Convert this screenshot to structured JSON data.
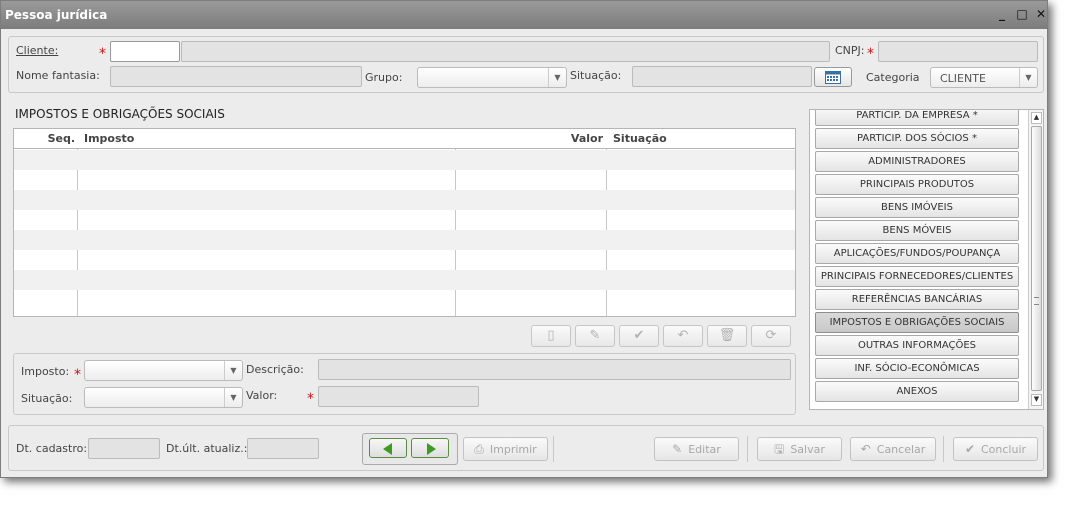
{
  "window": {
    "title": "Pessoa jurídica",
    "minimize": "_",
    "maximize": "□",
    "close": "✕"
  },
  "header": {
    "cliente_label": "Cliente:",
    "cnpj_label": "CNPJ:",
    "nome_fantasia_label": "Nome fantasia:",
    "grupo_label": "Grupo:",
    "situacao_label": "Situação:",
    "categoria_label": "Categoria",
    "categoria_value": "CLIENTE",
    "required_mark": "*"
  },
  "section": {
    "title": "IMPOSTOS E OBRIGAÇÕES SOCIAIS",
    "columns": {
      "seq": "Seq.",
      "imposto": "Imposto",
      "valor": "Valor",
      "situacao": "Situação"
    }
  },
  "toolbar_icons": [
    "new-icon",
    "edit-icon",
    "confirm-icon",
    "undo-icon",
    "delete-icon",
    "refresh-icon"
  ],
  "form": {
    "imposto_label": "Imposto:",
    "descricao_label": "Descrição:",
    "situacao_label": "Situação:",
    "valor_label": "Valor:"
  },
  "side_menu": [
    {
      "label": "PARTICIP. DA EMPRESA *",
      "selected": false
    },
    {
      "label": "PARTICIP. DOS SÓCIOS *",
      "selected": false
    },
    {
      "label": "ADMINISTRADORES",
      "selected": false
    },
    {
      "label": "PRINCIPAIS PRODUTOS",
      "selected": false
    },
    {
      "label": "BENS IMÓVEIS",
      "selected": false
    },
    {
      "label": "BENS MÓVEIS",
      "selected": false
    },
    {
      "label": "APLICAÇÕES/FUNDOS/POUPANÇA",
      "selected": false
    },
    {
      "label": "PRINCIPAIS FORNECEDORES/CLIENTES",
      "selected": false
    },
    {
      "label": "REFERÊNCIAS BANCÁRIAS",
      "selected": false
    },
    {
      "label": "IMPOSTOS E OBRIGAÇÕES SOCIAIS",
      "selected": true
    },
    {
      "label": "OUTRAS INFORMAÇÕES",
      "selected": false
    },
    {
      "label": "INF. SÓCIO-ECONÔMICAS",
      "selected": false
    },
    {
      "label": "ANEXOS",
      "selected": false
    }
  ],
  "footer": {
    "dt_cadastro_label": "Dt. cadastro:",
    "dt_ult_label": "Dt.últ. atualiz.:",
    "imprimir": "Imprimir",
    "editar": "Editar",
    "salvar": "Salvar",
    "cancelar": "Cancelar",
    "concluir": "Concluir"
  }
}
